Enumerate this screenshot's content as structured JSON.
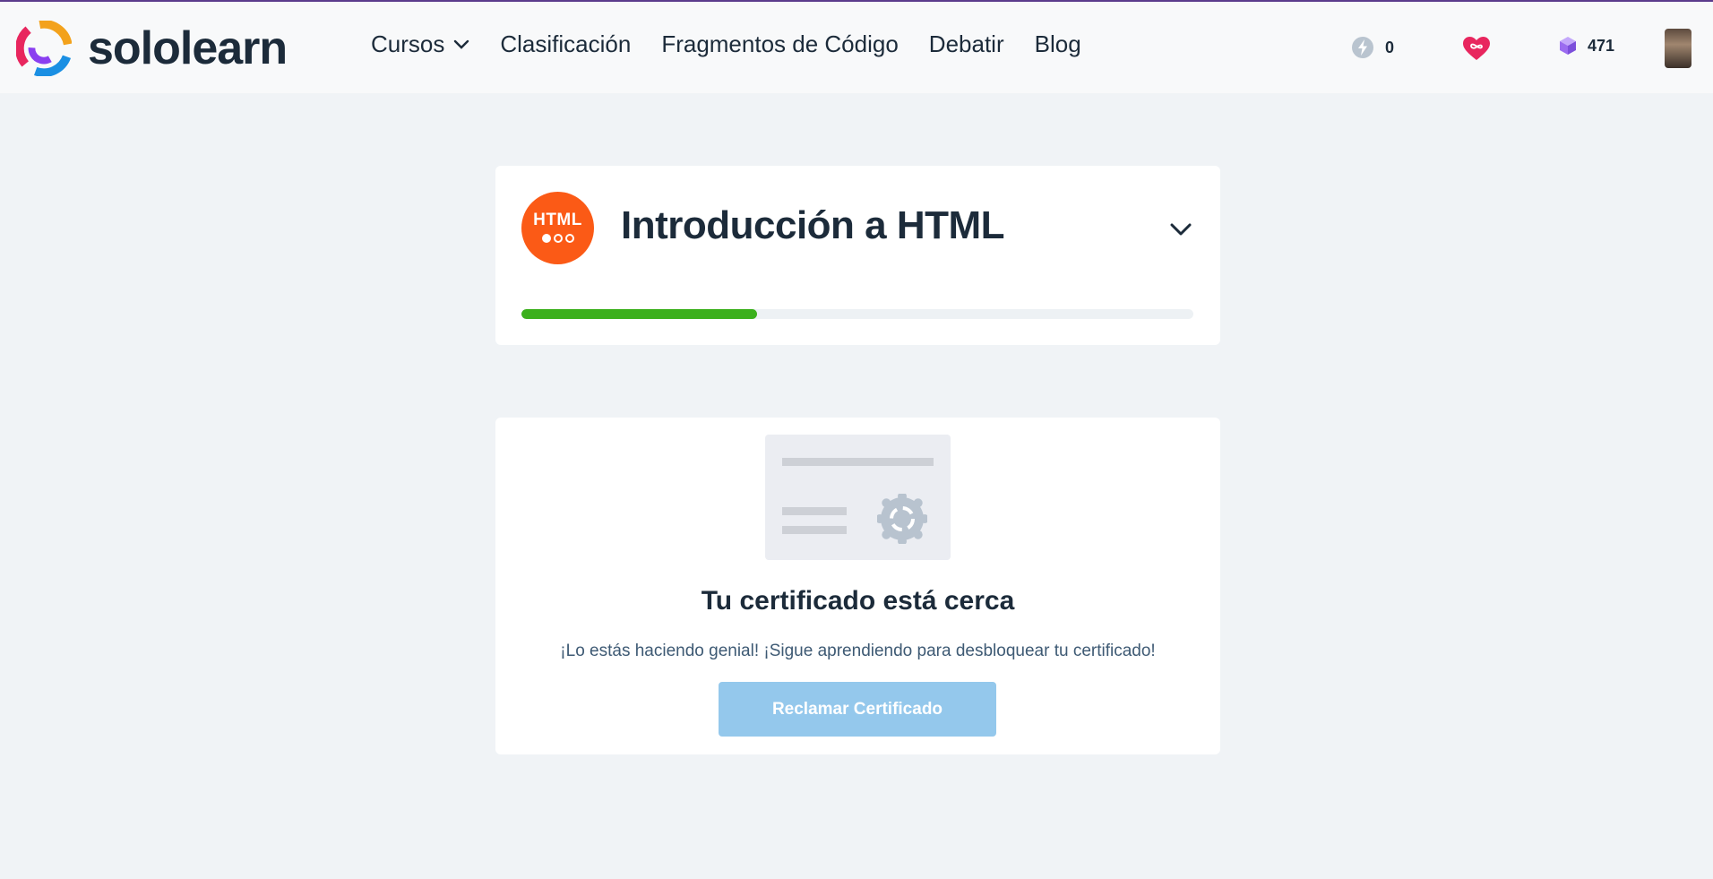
{
  "header": {
    "logo_text": "sololearn",
    "nav": [
      {
        "label": "Cursos",
        "has_dropdown": true
      },
      {
        "label": "Clasificación"
      },
      {
        "label": "Fragmentos de Código"
      },
      {
        "label": "Debatir"
      },
      {
        "label": "Blog"
      }
    ],
    "stats": {
      "energy": "0",
      "gems": "471"
    }
  },
  "course": {
    "badge_text": "HTML",
    "title": "Introducción a HTML",
    "progress_fraction": 0.35,
    "progress_color": "#3bb01c"
  },
  "certificate": {
    "title": "Tu certificado está cerca",
    "subtitle": "¡Lo estás haciendo genial! ¡Sigue aprendiendo para desbloquear tu certificado!",
    "button_label": "Reclamar Certificado"
  },
  "colors": {
    "accent_orange": "#fb5a16",
    "button_disabled": "#94c8ec",
    "heart": "#e8265e",
    "gem": "#9b6cf0"
  }
}
